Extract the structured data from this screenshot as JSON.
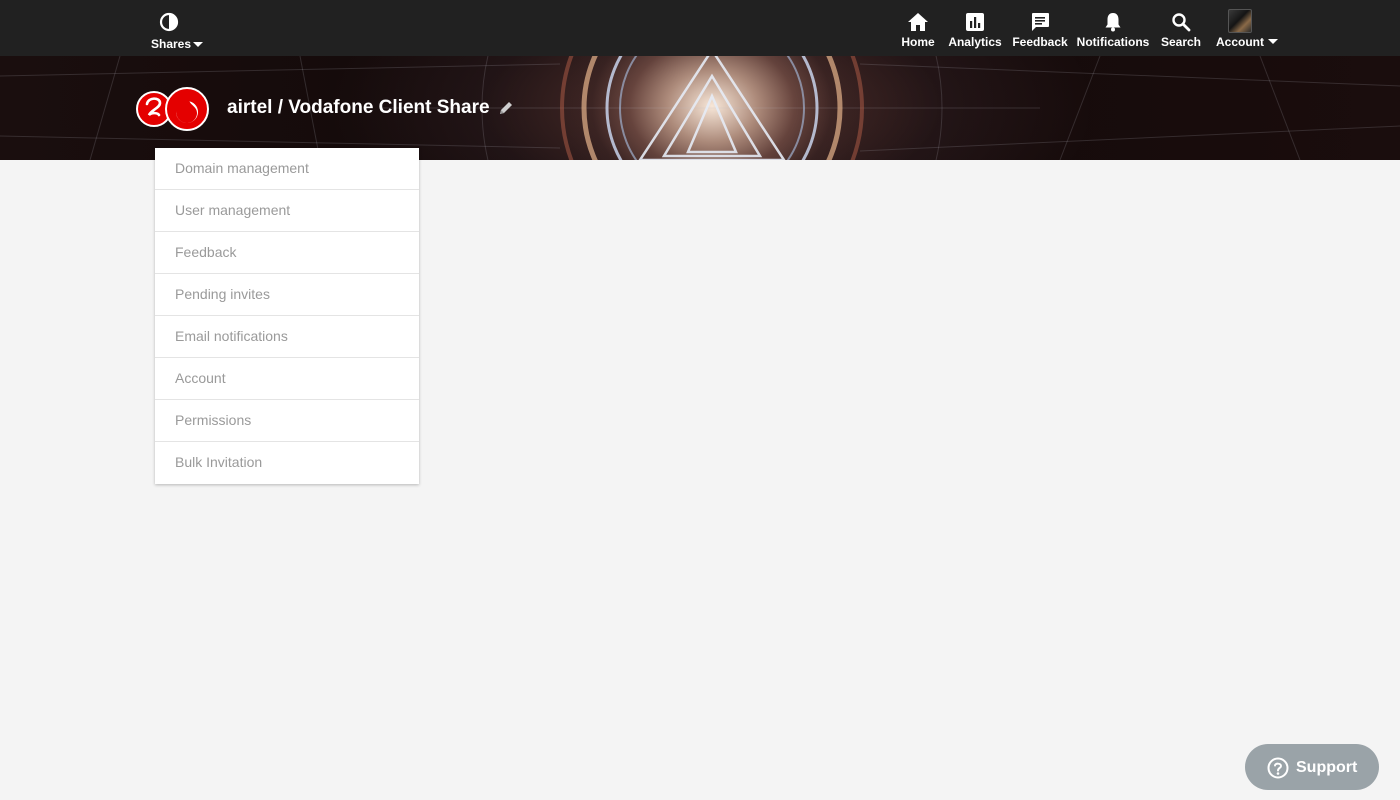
{
  "topbar": {
    "shares": {
      "label": "Shares",
      "icon": "half-circle-logo-icon"
    },
    "nav": [
      {
        "label": "Home",
        "icon": "home-icon"
      },
      {
        "label": "Analytics",
        "icon": "analytics-icon"
      },
      {
        "label": "Feedback",
        "icon": "feedback-icon"
      },
      {
        "label": "Notifications",
        "icon": "bell-icon"
      },
      {
        "label": "Search",
        "icon": "search-icon"
      },
      {
        "label": "Account",
        "icon": "avatar"
      }
    ]
  },
  "banner": {
    "title": "airtel / Vodafone Client Share",
    "logo": "airtel-vodafone-logo",
    "edit_icon": "pencil-icon"
  },
  "menu": {
    "items": [
      {
        "label": "Domain management"
      },
      {
        "label": "User management"
      },
      {
        "label": "Feedback"
      },
      {
        "label": "Pending invites"
      },
      {
        "label": "Email notifications"
      },
      {
        "label": "Account"
      },
      {
        "label": "Permissions"
      },
      {
        "label": "Bulk Invitation"
      }
    ]
  },
  "support": {
    "label": "Support",
    "icon": "question-icon"
  },
  "colors": {
    "topbar_bg": "#212121",
    "page_bg": "#f4f4f4",
    "menu_text": "#9a9a9a",
    "support_bg": "#9aa3a8",
    "brand_red": "#e40000"
  }
}
